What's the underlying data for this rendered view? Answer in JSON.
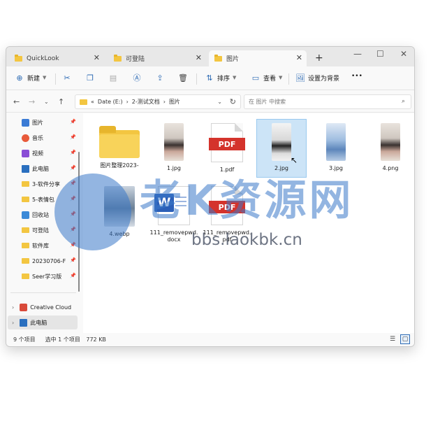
{
  "tabs": [
    {
      "label": "QuickLook",
      "active": false
    },
    {
      "label": "可登陆",
      "active": false
    },
    {
      "label": "图片",
      "active": true
    }
  ],
  "new_tab": "+",
  "window_controls": {
    "minimize": "—",
    "maximize": "☐",
    "close": "✕"
  },
  "toolbar": {
    "new_label": "新建",
    "sort_label": "排序",
    "view_label": "查看",
    "wallpaper_label": "设置为背景",
    "more_label": "•••"
  },
  "nav": {
    "breadcrumb": [
      "Date (E:)",
      "2-测试文档",
      "图片"
    ],
    "breadcrumb_prefix": "«",
    "search_placeholder": "在 图片 中搜索"
  },
  "sidebar": {
    "items": [
      {
        "label": "图片",
        "icon": "pictures-icon"
      },
      {
        "label": "音乐",
        "icon": "music-icon"
      },
      {
        "label": "视频",
        "icon": "video-icon"
      },
      {
        "label": "此电脑",
        "icon": "computer-icon"
      },
      {
        "label": "3-软件分享",
        "icon": "folder-icon"
      },
      {
        "label": "5-表情包",
        "icon": "folder-icon"
      },
      {
        "label": "回收站",
        "icon": "recycle-bin-icon"
      },
      {
        "label": "可登陆",
        "icon": "folder-icon"
      },
      {
        "label": "软件库",
        "icon": "folder-icon"
      },
      {
        "label": "20230706-F",
        "icon": "folder-icon"
      },
      {
        "label": "Seer学习版",
        "icon": "folder-icon"
      }
    ],
    "tree": [
      {
        "label": "Creative Cloud",
        "icon": "creative-cloud-icon"
      },
      {
        "label": "此电脑",
        "icon": "computer-icon"
      }
    ]
  },
  "files": [
    {
      "name": "图片整理2023-",
      "type": "folder"
    },
    {
      "name": "1.jpg",
      "type": "image"
    },
    {
      "name": "1.pdf",
      "type": "pdf"
    },
    {
      "name": "2.jpg",
      "type": "image",
      "selected": true
    },
    {
      "name": "3.jpg",
      "type": "image"
    },
    {
      "name": "4.png",
      "type": "image"
    },
    {
      "name": "4.webp",
      "type": "image"
    },
    {
      "name": "111_removepwd.docx",
      "type": "word"
    },
    {
      "name": "111_removepwd.pdf",
      "type": "pdf"
    }
  ],
  "status": {
    "item_count": "9 个项目",
    "selection": "选中 1 个项目",
    "size": "772 KB"
  },
  "watermark": {
    "text": "老K资源网",
    "url": "bbs.laokbk.cn"
  },
  "colors": {
    "accent": "#2f6cb5",
    "selection": "#cce4f7",
    "folder": "#f3c641",
    "pdf_red": "#d4332c",
    "word_blue": "#2b5fb8",
    "watermark": "#3a78c9"
  }
}
